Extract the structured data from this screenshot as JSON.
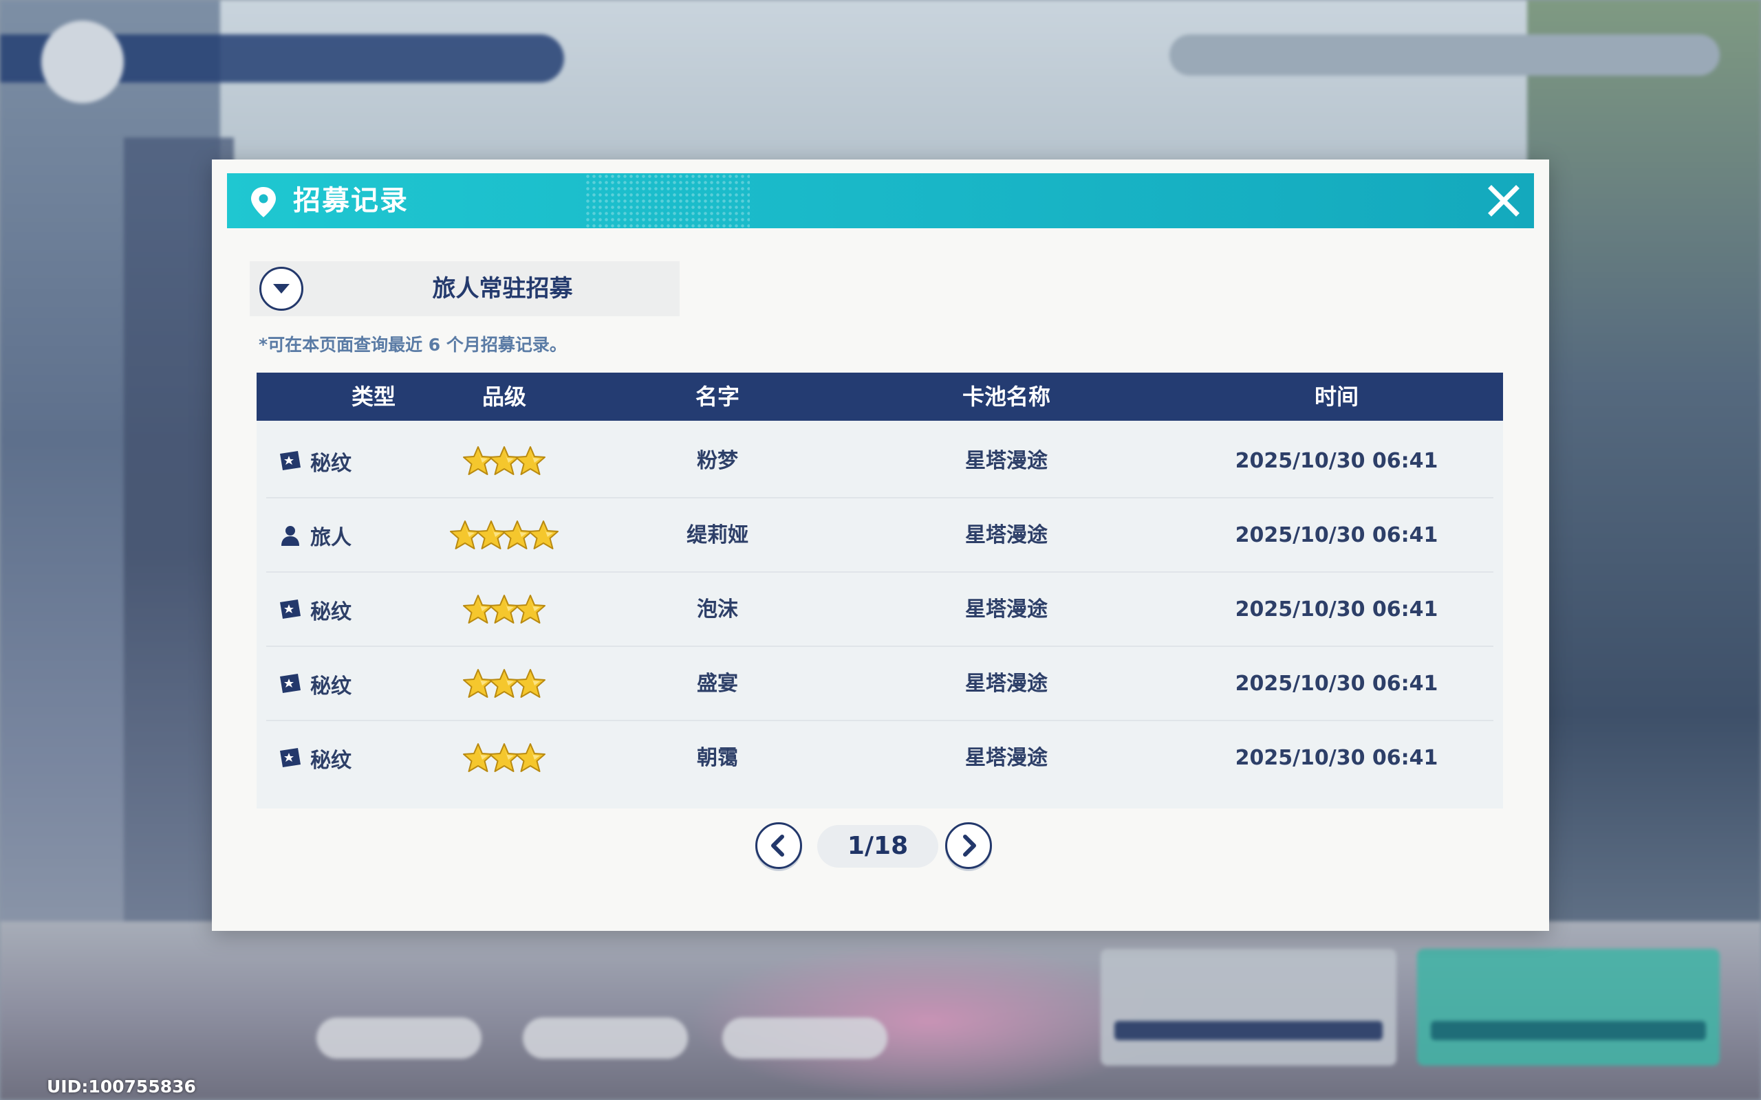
{
  "dialog": {
    "title": "招募记录",
    "title_icon": "location-pin-icon",
    "close_icon": "close-icon"
  },
  "pool_selector": {
    "selected": "旅人常驻招募",
    "icon": "chevron-down-icon"
  },
  "note": "*可在本页面查询最近 6 个月招募记录。",
  "table": {
    "headers": [
      "类型",
      "品级",
      "名字",
      "卡池名称",
      "时间"
    ],
    "rows": [
      {
        "type": "秘纹",
        "type_icon": "ticket-star-icon",
        "stars": 3,
        "name": "粉梦",
        "pool": "星塔漫途",
        "time": "2025/10/30 06:41"
      },
      {
        "type": "旅人",
        "type_icon": "person-icon",
        "stars": 4,
        "name": "缇莉娅",
        "pool": "星塔漫途",
        "time": "2025/10/30 06:41"
      },
      {
        "type": "秘纹",
        "type_icon": "ticket-star-icon",
        "stars": 3,
        "name": "泡沫",
        "pool": "星塔漫途",
        "time": "2025/10/30 06:41"
      },
      {
        "type": "秘纹",
        "type_icon": "ticket-star-icon",
        "stars": 3,
        "name": "盛宴",
        "pool": "星塔漫途",
        "time": "2025/10/30 06:41"
      },
      {
        "type": "秘纹",
        "type_icon": "ticket-star-icon",
        "stars": 3,
        "name": "朝霭",
        "pool": "星塔漫途",
        "time": "2025/10/30 06:41"
      }
    ]
  },
  "pagination": {
    "label": "1/18",
    "prev_icon": "chevron-left-icon",
    "next_icon": "chevron-right-icon"
  },
  "uid": "UID:100755836",
  "colors": {
    "title_bar": "#1fc7d1",
    "table_header": "#243c72",
    "text_dark": "#2d3f68",
    "star": "#f5c72d"
  }
}
